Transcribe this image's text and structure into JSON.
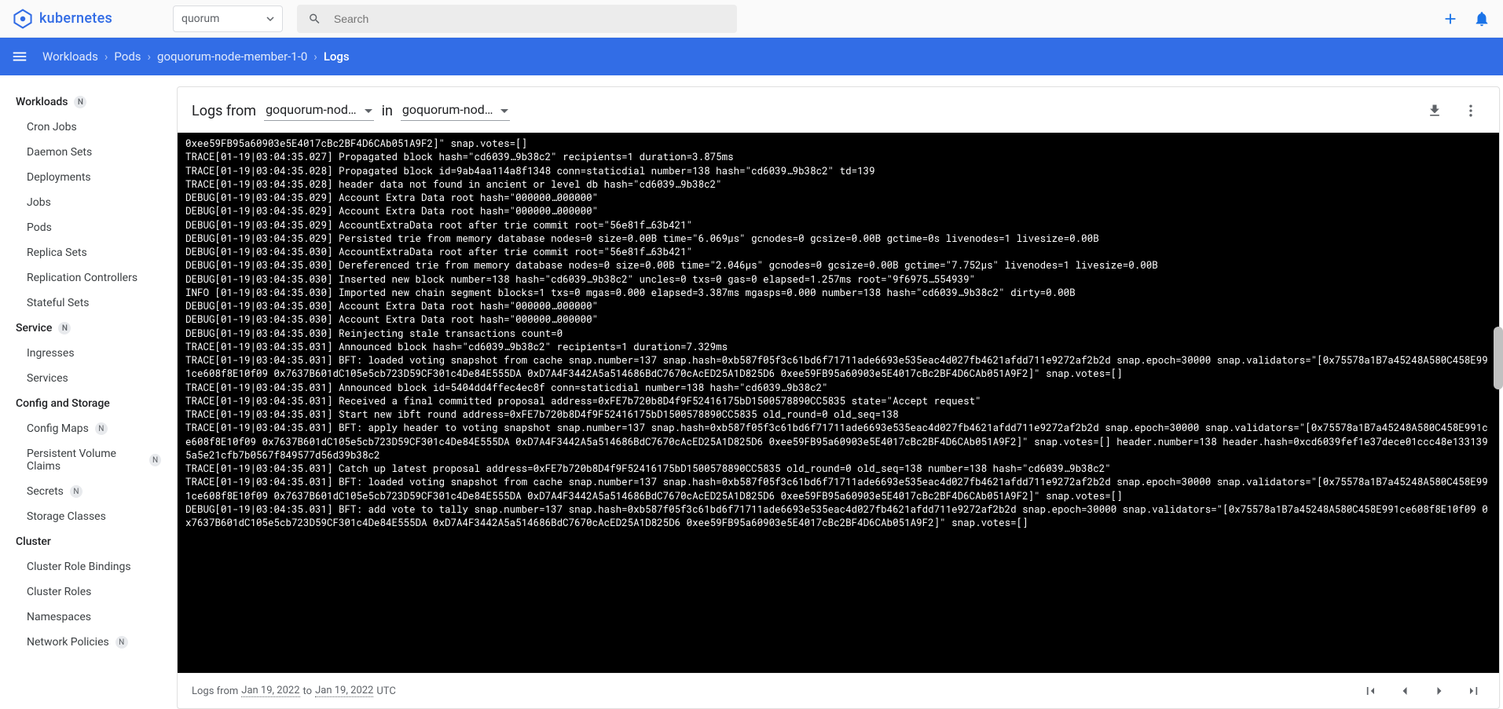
{
  "header": {
    "brand": "kubernetes",
    "namespace": "quorum",
    "search_placeholder": "Search"
  },
  "breadcrumbs": [
    {
      "label": "Workloads",
      "active": false
    },
    {
      "label": "Pods",
      "active": false
    },
    {
      "label": "goquorum-node-member-1-0",
      "active": false
    },
    {
      "label": "Logs",
      "active": true
    }
  ],
  "sidebar": {
    "sections": [
      {
        "heading": "Workloads",
        "badge": "N",
        "items": [
          {
            "label": "Cron Jobs"
          },
          {
            "label": "Daemon Sets"
          },
          {
            "label": "Deployments"
          },
          {
            "label": "Jobs"
          },
          {
            "label": "Pods"
          },
          {
            "label": "Replica Sets"
          },
          {
            "label": "Replication Controllers"
          },
          {
            "label": "Stateful Sets"
          }
        ]
      },
      {
        "heading": "Service",
        "badge": "N",
        "items": [
          {
            "label": "Ingresses"
          },
          {
            "label": "Services"
          }
        ]
      },
      {
        "heading": "Config and Storage",
        "items": [
          {
            "label": "Config Maps",
            "badge": "N"
          },
          {
            "label": "Persistent Volume Claims",
            "badge": "N"
          },
          {
            "label": "Secrets",
            "badge": "N"
          },
          {
            "label": "Storage Classes"
          }
        ]
      },
      {
        "heading": "Cluster",
        "items": [
          {
            "label": "Cluster Role Bindings"
          },
          {
            "label": "Cluster Roles"
          },
          {
            "label": "Namespaces"
          },
          {
            "label": "Network Policies",
            "badge": "N"
          }
        ]
      }
    ]
  },
  "logs": {
    "from_label": "Logs from",
    "container": "goquorum-nod…",
    "in_label": "in",
    "pod": "goquorum-nod…",
    "footer_prefix": "Logs from ",
    "footer_from": "Jan 19, 2022",
    "footer_to_label": " to ",
    "footer_to": "Jan 19, 2022",
    "footer_tz": " UTC",
    "lines": [
      "0xee59FB95a60903e5E4017cBc2BF4D6CAb051A9F2]\" snap.votes=[]",
      "TRACE[01-19|03:04:35.027] Propagated block hash=\"cd6039…9b38c2\" recipients=1 duration=3.875ms",
      "TRACE[01-19|03:04:35.028] Propagated block id=9ab4aa114a8f1348 conn=staticdial number=138 hash=\"cd6039…9b38c2\" td=139",
      "TRACE[01-19|03:04:35.028] header data not found in ancient or level db hash=\"cd6039…9b38c2\"",
      "DEBUG[01-19|03:04:35.029] Account Extra Data root hash=\"000000…000000\"",
      "DEBUG[01-19|03:04:35.029] Account Extra Data root hash=\"000000…000000\"",
      "DEBUG[01-19|03:04:35.029] AccountExtraData root after trie commit root=\"56e81f…63b421\"",
      "DEBUG[01-19|03:04:35.029] Persisted trie from memory database nodes=0 size=0.00B time=\"6.069µs\" gcnodes=0 gcsize=0.00B gctime=0s livenodes=1 livesize=0.00B",
      "DEBUG[01-19|03:04:35.030] AccountExtraData root after trie commit root=\"56e81f…63b421\"",
      "DEBUG[01-19|03:04:35.030] Dereferenced trie from memory database nodes=0 size=0.00B time=\"2.046µs\" gcnodes=0 gcsize=0.00B gctime=\"7.752µs\" livenodes=1 livesize=0.00B",
      "DEBUG[01-19|03:04:35.030] Inserted new block number=138 hash=\"cd6039…9b38c2\" uncles=0 txs=0 gas=0 elapsed=1.257ms root=\"9f6975…554939\"",
      "INFO [01-19|03:04:35.030] Imported new chain segment blocks=1 txs=0 mgas=0.000 elapsed=3.387ms mgasps=0.000 number=138 hash=\"cd6039…9b38c2\" dirty=0.00B",
      "DEBUG[01-19|03:04:35.030] Account Extra Data root hash=\"000000…000000\"",
      "DEBUG[01-19|03:04:35.030] Account Extra Data root hash=\"000000…000000\"",
      "DEBUG[01-19|03:04:35.030] Reinjecting stale transactions count=0",
      "TRACE[01-19|03:04:35.031] Announced block hash=\"cd6039…9b38c2\" recipients=1 duration=7.329ms",
      "TRACE[01-19|03:04:35.031] BFT: loaded voting snapshot from cache snap.number=137 snap.hash=0xb587f05f3c61bd6f71711ade6693e535eac4d027fb4621afdd711e9272af2b2d snap.epoch=30000 snap.validators=\"[0x75578a1B7a45248A580C458E991ce608f8E10f09 0x7637B601dC105e5cb723D59CF301c4De84E555DA 0xD7A4F3442A5a514686BdC7670cAcED25A1D825D6 0xee59FB95a60903e5E4017cBc2BF4D6CAb051A9F2]\" snap.votes=[]",
      "TRACE[01-19|03:04:35.031] Announced block id=5404dd4ffec4ec8f conn=staticdial number=138 hash=\"cd6039…9b38c2\"",
      "TRACE[01-19|03:04:35.031] Received a final committed proposal address=0xFE7b720b8D4f9F52416175bD1500578890CC5835 state=\"Accept request\"",
      "TRACE[01-19|03:04:35.031] Start new ibft round address=0xFE7b720b8D4f9F52416175bD1500578890CC5835 old_round=0 old_seq=138",
      "TRACE[01-19|03:04:35.031] BFT: apply header to voting snapshot snap.number=137 snap.hash=0xb587f05f3c61bd6f71711ade6693e535eac4d027fb4621afdd711e9272af2b2d snap.epoch=30000 snap.validators=\"[0x75578a1B7a45248A580C458E991ce608f8E10f09 0x7637B601dC105e5cb723D59CF301c4De84E555DA 0xD7A4F3442A5a514686BdC7670cAcED25A1D825D6 0xee59FB95a60903e5E4017cBc2BF4D6CAb051A9F2]\" snap.votes=[] header.number=138 header.hash=0xcd6039fef1e37dece01ccc48e1331395a5e21cfb7b0567f849577d56d39b38c2",
      "TRACE[01-19|03:04:35.031] Catch up latest proposal address=0xFE7b720b8D4f9F52416175bD1500578890CC5835 old_round=0 old_seq=138 number=138 hash=\"cd6039…9b38c2\"",
      "TRACE[01-19|03:04:35.031] BFT: loaded voting snapshot from cache snap.number=137 snap.hash=0xb587f05f3c61bd6f71711ade6693e535eac4d027fb4621afdd711e9272af2b2d snap.epoch=30000 snap.validators=\"[0x75578a1B7a45248A580C458E991ce608f8E10f09 0x7637B601dC105e5cb723D59CF301c4De84E555DA 0xD7A4F3442A5a514686BdC7670cAcED25A1D825D6 0xee59FB95a60903e5E4017cBc2BF4D6CAb051A9F2]\" snap.votes=[]",
      "DEBUG[01-19|03:04:35.031] BFT: add vote to tally snap.number=137 snap.hash=0xb587f05f3c61bd6f71711ade6693e535eac4d027fb4621afdd711e9272af2b2d snap.epoch=30000 snap.validators=\"[0x75578a1B7a45248A580C458E991ce608f8E10f09 0x7637B601dC105e5cb723D59CF301c4De84E555DA 0xD7A4F3442A5a514686BdC7670cAcED25A1D825D6 0xee59FB95a60903e5E4017cBc2BF4D6CAb051A9F2]\" snap.votes=[]"
    ]
  }
}
